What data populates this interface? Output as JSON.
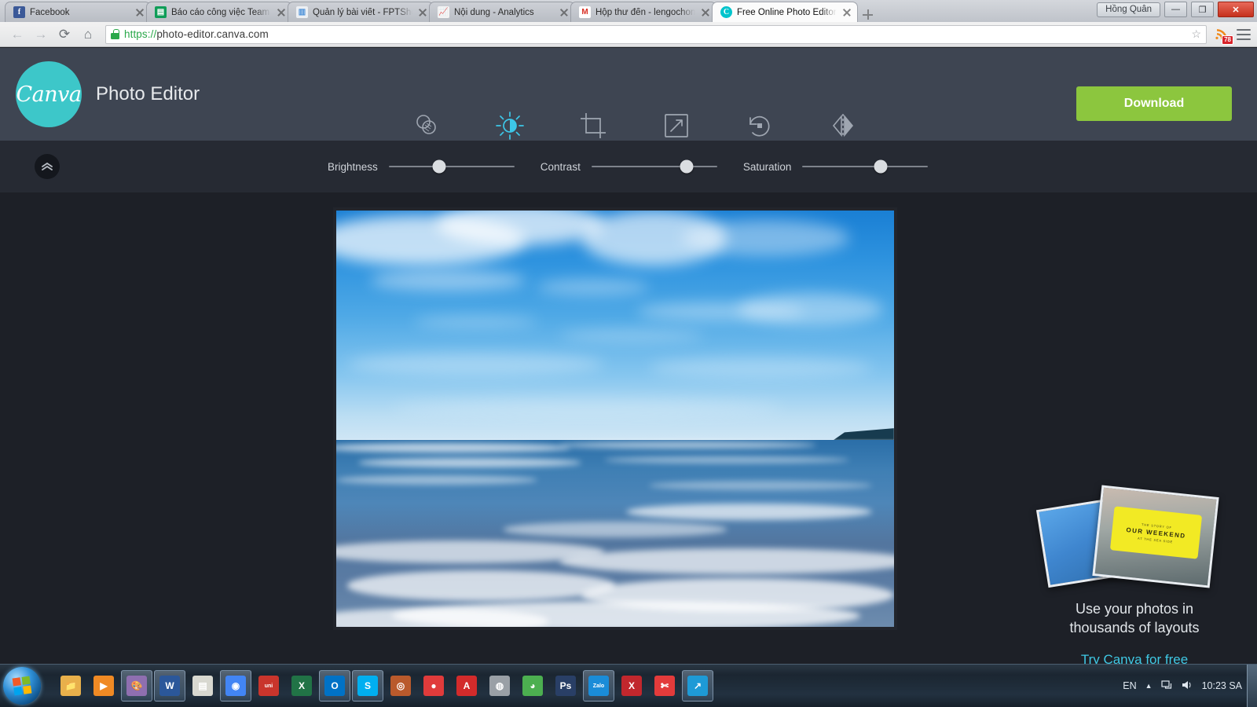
{
  "browser": {
    "tabs": [
      {
        "title": "Facebook",
        "favicon": "facebook-icon",
        "active": false
      },
      {
        "title": "Báo cáo công việc Team C",
        "favicon": "google-sheets-icon",
        "active": false
      },
      {
        "title": "Quản lý bài viết - FPTShop",
        "favicon": "document-icon",
        "active": false
      },
      {
        "title": "Nội dung - Analytics",
        "favicon": "google-analytics-icon",
        "active": false
      },
      {
        "title": "Hộp thư đến - lengochon",
        "favicon": "gmail-icon",
        "active": false
      },
      {
        "title": "Free Online Photo Editor -",
        "favicon": "canva-icon",
        "active": true
      }
    ],
    "window": {
      "user_label": "Hồng Quân",
      "minimize_label": "—",
      "maximize_label": "❐",
      "close_label": "✕"
    },
    "toolbar": {
      "back_label": "←",
      "forward_label": "→",
      "reload_label": "⟳",
      "home_label": "⌂",
      "url_scheme": "https://",
      "url_rest": "photo-editor.canva.com",
      "url_full": "https://photo-editor.canva.com",
      "bookmark_label": "☆",
      "rss_badge": "78",
      "menu_label": "menu"
    }
  },
  "app": {
    "logo_text": "Canva",
    "title": "Photo Editor",
    "download_label": "Download",
    "tools": [
      {
        "label": "FILTER",
        "icon": "filter-icon",
        "active": false
      },
      {
        "label": "ADJUST",
        "icon": "brightness-icon",
        "active": true
      },
      {
        "label": "CROP",
        "icon": "crop-icon",
        "active": false
      },
      {
        "label": "RESIZE",
        "icon": "resize-icon",
        "active": false
      },
      {
        "label": "ROTATE",
        "icon": "rotate-icon",
        "active": false
      },
      {
        "label": "FLIP",
        "icon": "flip-icon",
        "active": false
      }
    ],
    "collapse_label": "⌃",
    "sliders": [
      {
        "label": "Brightness",
        "value": 40
      },
      {
        "label": "Contrast",
        "value": 76
      },
      {
        "label": "Saturation",
        "value": 62
      }
    ],
    "photo": {
      "alt": "Beach photo with blue sky, clouds and ocean waves"
    },
    "promo": {
      "card_tag_title": "OUR WEEKEND",
      "card_tag_sub": "THE STORY OF",
      "card_tag_foot": "AT THE SEA SIDE",
      "line1": "Use your photos in",
      "line2": "thousands of layouts",
      "link": "Try Canva for free"
    }
  },
  "taskbar": {
    "start_label": "Start",
    "items": [
      {
        "name": "file-explorer",
        "label": "📁",
        "pinned": false,
        "color": "#e8b04b"
      },
      {
        "name": "media-player",
        "label": "▶",
        "pinned": false,
        "color": "#f08a24"
      },
      {
        "name": "paint-app",
        "label": "🎨",
        "pinned": true,
        "color": "#8f6fb0"
      },
      {
        "name": "word",
        "label": "W",
        "pinned": true,
        "color": "#2b579a"
      },
      {
        "name": "notepad",
        "label": "▤",
        "pinned": false,
        "color": "#d8d8d0"
      },
      {
        "name": "chrome",
        "label": "◉",
        "pinned": true,
        "color": "#4285f4"
      },
      {
        "name": "unikey",
        "label": "uni",
        "pinned": false,
        "color": "#c9352c"
      },
      {
        "name": "excel",
        "label": "X",
        "pinned": false,
        "color": "#217346"
      },
      {
        "name": "outlook",
        "label": "O",
        "pinned": true,
        "color": "#0072c6"
      },
      {
        "name": "skype",
        "label": "S",
        "pinned": true,
        "color": "#00aff0"
      },
      {
        "name": "antivirus",
        "label": "◎",
        "pinned": false,
        "color": "#b95a2c"
      },
      {
        "name": "cloud-app",
        "label": "●",
        "pinned": false,
        "color": "#e03b3b"
      },
      {
        "name": "adobe-reader",
        "label": "A",
        "pinned": false,
        "color": "#d32b2b"
      },
      {
        "name": "mouse-tool",
        "label": "◍",
        "pinned": false,
        "color": "#9aa0a6"
      },
      {
        "name": "green-disc",
        "label": "◕",
        "pinned": false,
        "color": "#4caf50"
      },
      {
        "name": "photoshop",
        "label": "Ps",
        "pinned": false,
        "color": "#293f66"
      },
      {
        "name": "zalo",
        "label": "Zalo",
        "pinned": true,
        "color": "#1a8cd8"
      },
      {
        "name": "x-app",
        "label": "X",
        "pinned": false,
        "color": "#c1272d"
      },
      {
        "name": "scissors-app",
        "label": "✄",
        "pinned": false,
        "color": "#e33b3b"
      },
      {
        "name": "shortcut-app",
        "label": "↗",
        "pinned": true,
        "color": "#1e9ad6"
      }
    ],
    "tray": {
      "language": "EN",
      "show_hidden_label": "▲",
      "network_label": "network",
      "volume_label": "volume",
      "clock": "10:23 SA"
    }
  }
}
